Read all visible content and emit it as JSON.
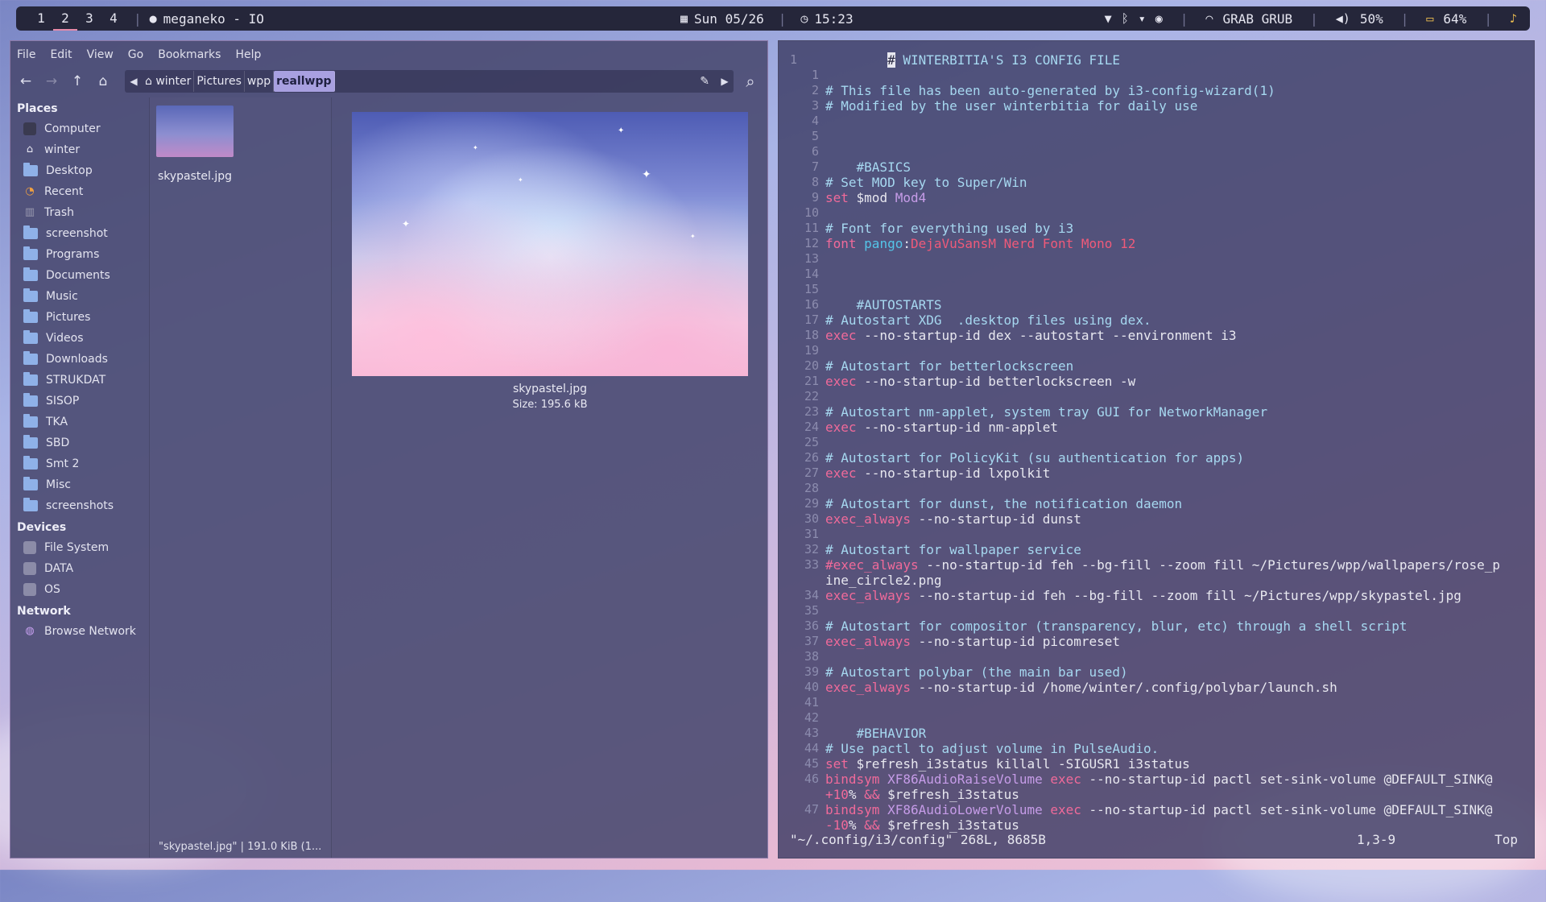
{
  "topbar": {
    "workspaces": [
      "1",
      "2",
      "3",
      "4"
    ],
    "active_workspace": "2",
    "now_playing": "meganeko - IO",
    "date": "Sun 05/26",
    "time": "15:23",
    "wifi_name": "GRAB GRUB",
    "volume": "50%",
    "battery": "64%"
  },
  "file_manager": {
    "menu": [
      "File",
      "Edit",
      "View",
      "Go",
      "Bookmarks",
      "Help"
    ],
    "breadcrumbs": [
      "winter",
      "Pictures",
      "wpp",
      "reallwpp"
    ],
    "sidebar": {
      "places_label": "Places",
      "places": [
        "Computer",
        "winter",
        "Desktop",
        "Recent",
        "Trash",
        "screenshot",
        "Programs",
        "Documents",
        "Music",
        "Pictures",
        "Videos",
        "Downloads",
        "STRUKDAT",
        "SISOP",
        "TKA",
        "SBD",
        "Smt 2",
        "Misc",
        "screenshots"
      ],
      "devices_label": "Devices",
      "devices": [
        "File System",
        "DATA",
        "OS"
      ],
      "network_label": "Network",
      "network": [
        "Browse Network"
      ]
    },
    "file_name": "skypastel.jpg",
    "preview_name": "skypastel.jpg",
    "preview_size": "Size: 195.6 kB",
    "status": "\"skypastel.jpg\"  |  191.0 KiB (1..."
  },
  "editor": {
    "lines": [
      {
        "n": "1",
        "t": "        # WINTERBITIA'S I3 CONFIG FILE"
      },
      {
        "n": "1",
        "t": ""
      },
      {
        "n": "2",
        "t": "# This file has been auto-generated by i3-config-wizard(1)"
      },
      {
        "n": "3",
        "t": "# Modified by the user winterbitia for daily use"
      },
      {
        "n": "4",
        "t": ""
      },
      {
        "n": "5",
        "t": ""
      },
      {
        "n": "6",
        "t": ""
      },
      {
        "n": "7",
        "t": "    #BASICS"
      },
      {
        "n": "8",
        "t": "# Set MOD key to Super/Win"
      },
      {
        "n": "9",
        "t": "set $mod Mod4"
      },
      {
        "n": "10",
        "t": ""
      },
      {
        "n": "11",
        "t": "# Font for everything used by i3"
      },
      {
        "n": "12",
        "t": "font pango:DejaVuSansM Nerd Font Mono 12"
      },
      {
        "n": "13",
        "t": ""
      },
      {
        "n": "14",
        "t": ""
      },
      {
        "n": "15",
        "t": ""
      },
      {
        "n": "16",
        "t": "    #AUTOSTARTS"
      },
      {
        "n": "17",
        "t": "# Autostart XDG  .desktop files using dex."
      },
      {
        "n": "18",
        "t": "exec --no-startup-id dex --autostart --environment i3"
      },
      {
        "n": "19",
        "t": ""
      },
      {
        "n": "20",
        "t": "# Autostart for betterlockscreen"
      },
      {
        "n": "21",
        "t": "exec --no-startup-id betterlockscreen -w"
      },
      {
        "n": "22",
        "t": ""
      },
      {
        "n": "23",
        "t": "# Autostart nm-applet, system tray GUI for NetworkManager"
      },
      {
        "n": "24",
        "t": "exec --no-startup-id nm-applet"
      },
      {
        "n": "25",
        "t": ""
      },
      {
        "n": "26",
        "t": "# Autostart for PolicyKit (su authentication for apps)"
      },
      {
        "n": "27",
        "t": "exec --no-startup-id lxpolkit"
      },
      {
        "n": "28",
        "t": ""
      },
      {
        "n": "29",
        "t": "# Autostart for dunst, the notification daemon"
      },
      {
        "n": "30",
        "t": "exec_always --no-startup-id dunst"
      },
      {
        "n": "31",
        "t": ""
      },
      {
        "n": "32",
        "t": "# Autostart for wallpaper service"
      },
      {
        "n": "33",
        "t": "#exec_always --no-startup-id feh --bg-fill --zoom fill ~/Pictures/wpp/wallpapers/rose_p"
      },
      {
        "n": "",
        "t": "ine_circle2.png"
      },
      {
        "n": "34",
        "t": "exec_always --no-startup-id feh --bg-fill --zoom fill ~/Pictures/wpp/skypastel.jpg"
      },
      {
        "n": "35",
        "t": ""
      },
      {
        "n": "36",
        "t": "# Autostart for compositor (transparency, blur, etc) through a shell script"
      },
      {
        "n": "37",
        "t": "exec_always --no-startup-id picomreset"
      },
      {
        "n": "38",
        "t": ""
      },
      {
        "n": "39",
        "t": "# Autostart polybar (the main bar used)"
      },
      {
        "n": "40",
        "t": "exec_always --no-startup-id /home/winter/.config/polybar/launch.sh"
      },
      {
        "n": "41",
        "t": ""
      },
      {
        "n": "42",
        "t": ""
      },
      {
        "n": "43",
        "t": "    #BEHAVIOR"
      },
      {
        "n": "44",
        "t": "# Use pactl to adjust volume in PulseAudio."
      },
      {
        "n": "45",
        "t": "set $refresh_i3status killall -SIGUSR1 i3status"
      },
      {
        "n": "46",
        "t": "bindsym XF86AudioRaiseVolume exec --no-startup-id pactl set-sink-volume @DEFAULT_SINK@"
      },
      {
        "n": "",
        "t": "+10% && $refresh_i3status"
      },
      {
        "n": "47",
        "t": "bindsym XF86AudioLowerVolume exec --no-startup-id pactl set-sink-volume @DEFAULT_SINK@"
      },
      {
        "n": "",
        "t": "-10% && $refresh_i3status"
      }
    ],
    "status_file": "\"~/.config/i3/config\" 268L, 8685B",
    "status_pos": "1,3-9",
    "status_pct": "Top"
  }
}
